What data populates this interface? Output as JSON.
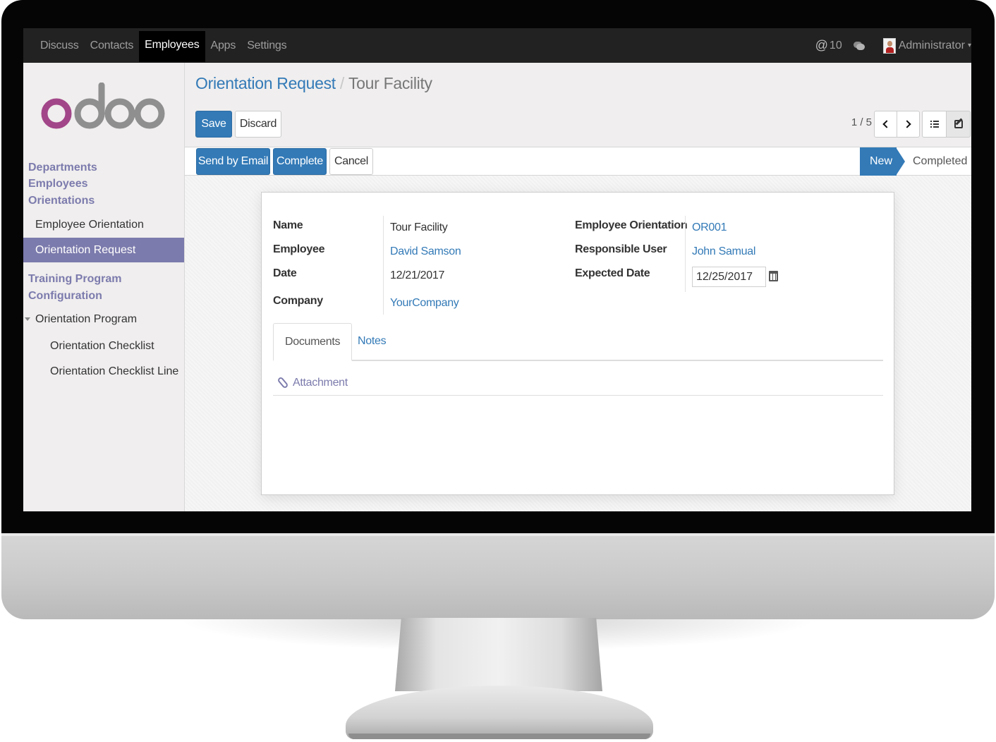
{
  "topbar": {
    "menu": [
      "Discuss",
      "Contacts",
      "Employees",
      "Apps",
      "Settings"
    ],
    "active_menu": "Employees",
    "mentions_count": "10",
    "user_name": "Administrator"
  },
  "sidebar": {
    "logo_text": "odoo",
    "sections": [
      "Departments",
      "Employees",
      "Orientations"
    ],
    "orientation_items": [
      "Employee Orientation",
      "Orientation Request"
    ],
    "active_item": "Orientation Request",
    "sections2": [
      "Training Program",
      "Configuration"
    ],
    "config_group": "Orientation Program",
    "config_items": [
      "Orientation Checklist",
      "Orientation Checklist Line"
    ]
  },
  "breadcrumb": {
    "parent": "Orientation Request",
    "separator": "/",
    "current": "Tour Facility"
  },
  "buttons": {
    "save": "Save",
    "discard": "Discard",
    "send_email": "Send by Email",
    "complete": "Complete",
    "cancel": "Cancel"
  },
  "pager": {
    "value": "1 / 5"
  },
  "status": {
    "stages": [
      "New",
      "Completed"
    ],
    "current": "New"
  },
  "form": {
    "labels": {
      "name": "Name",
      "employee": "Employee",
      "date": "Date",
      "company": "Company",
      "employee_orientation": "Employee Orientation",
      "responsible_user": "Responsible User",
      "expected_date": "Expected Date"
    },
    "values": {
      "name": "Tour Facility",
      "employee": "David Samson",
      "date": "12/21/2017",
      "company": "YourCompany",
      "employee_orientation": "OR001",
      "responsible_user": "John Samual",
      "expected_date": "12/25/2017"
    },
    "tabs": [
      "Documents",
      "Notes"
    ],
    "active_tab": "Documents",
    "attachment_label": "Attachment"
  },
  "colors": {
    "brand_purple": "#7c7bad",
    "primary_blue": "#337ab7",
    "topbar": "#222222"
  }
}
